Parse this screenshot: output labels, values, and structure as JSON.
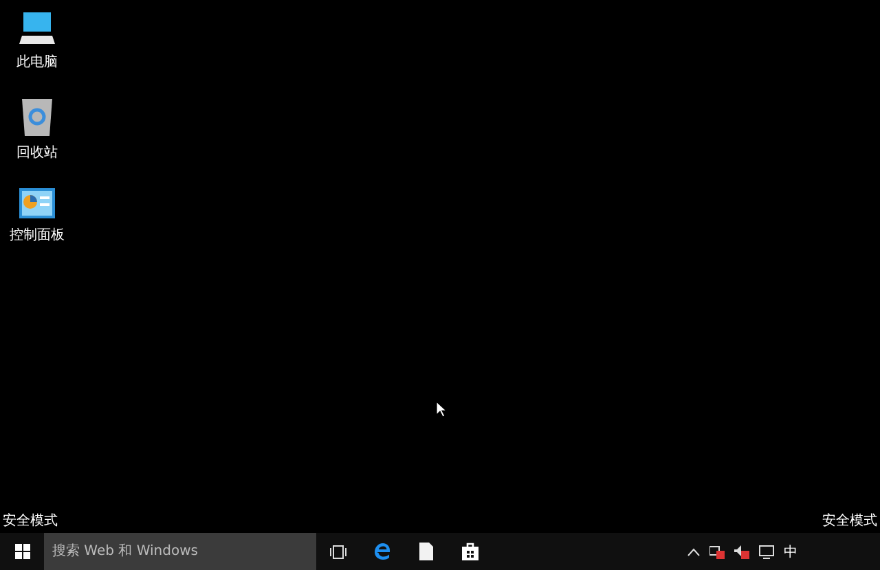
{
  "desktop_icons": [
    {
      "kind": "computer",
      "label": "此电脑"
    },
    {
      "kind": "recycle",
      "label": "回收站"
    },
    {
      "kind": "control",
      "label": "控制面板"
    }
  ],
  "safe_mode_labels": [
    "安全模式",
    "安全模式"
  ],
  "taskbar": {
    "search": {
      "placeholder": "搜索 Web 和 Windows"
    },
    "tray_ime": "中"
  }
}
